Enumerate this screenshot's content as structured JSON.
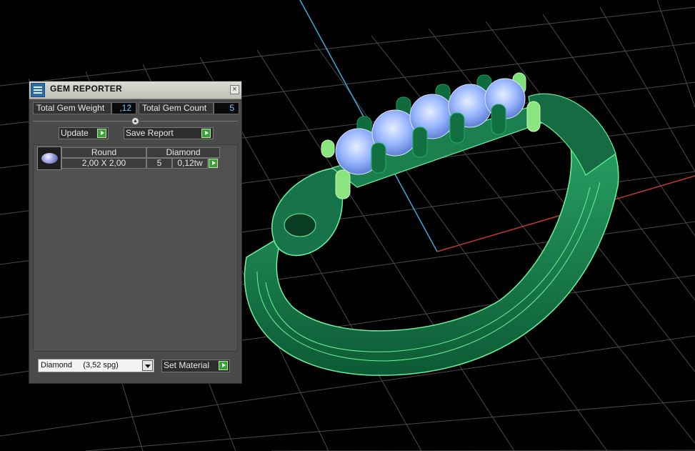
{
  "window": {
    "title": "GEM REPORTER",
    "close_icon": "close-icon"
  },
  "summary": {
    "weight_label": "Total Gem Weight",
    "weight_value": ",12",
    "count_label": "Total Gem Count",
    "count_value": "5"
  },
  "actions": {
    "update_label": "Update",
    "save_report_label": "Save Report"
  },
  "gems": [
    {
      "shape": "Round",
      "material": "Diamond",
      "size": "2,00 X 2,00",
      "count": "5",
      "weight": "0,12tw",
      "thumb_icon": "round-gem-icon"
    }
  ],
  "material_select": {
    "value": "Diamond     (3,52 spg)"
  },
  "set_material_label": "Set Material",
  "colors": {
    "panel_bg": "#4a4a4a",
    "value_text": "#6fc6ff",
    "ring_green": "#1f8a55",
    "gem_blue": "#9bb8ff",
    "grid": "#4a4a4a",
    "axis_y": "#3fa9d6",
    "axis_x": "#c0392b"
  }
}
